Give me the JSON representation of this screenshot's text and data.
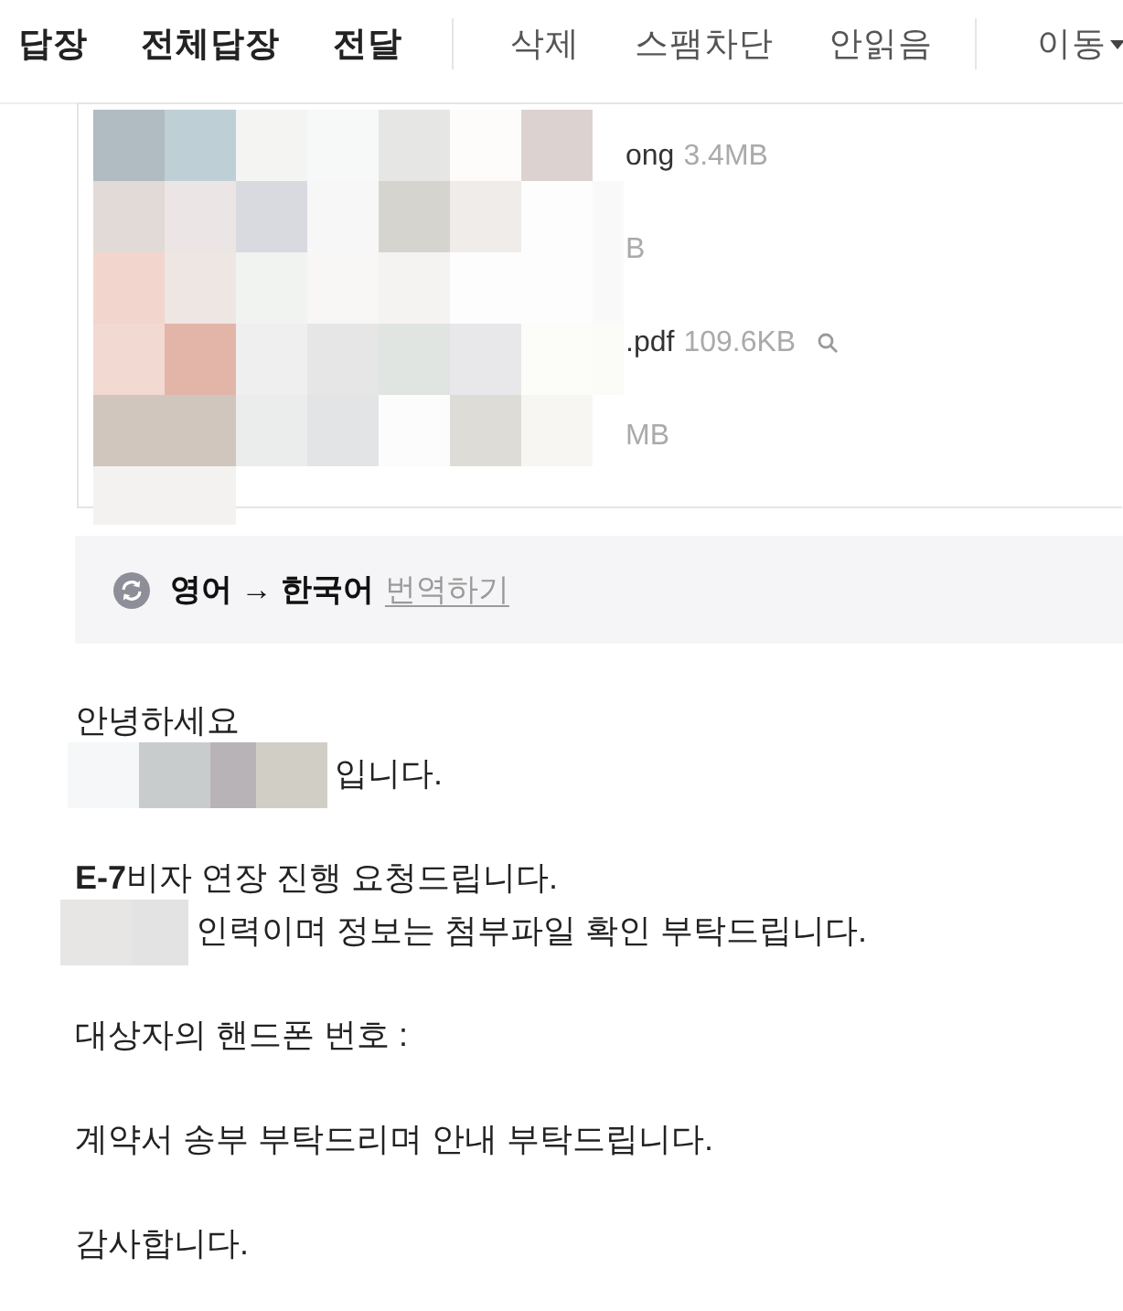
{
  "toolbar": {
    "groups": [
      {
        "kind": "primary",
        "items": [
          {
            "label": "답장",
            "dropdown": false
          },
          {
            "label": "전체답장",
            "dropdown": false
          },
          {
            "label": "전달",
            "dropdown": false
          }
        ]
      },
      {
        "kind": "secondary",
        "items": [
          {
            "label": "삭제",
            "dropdown": false
          },
          {
            "label": "스팸차단",
            "dropdown": false
          },
          {
            "label": "안읽음",
            "dropdown": false
          }
        ]
      },
      {
        "kind": "secondary",
        "items": [
          {
            "label": "이동",
            "dropdown": true
          }
        ]
      }
    ]
  },
  "attachments": [
    {
      "name": "ong",
      "size": "3.4MB"
    },
    {
      "size": "B"
    },
    {
      "name": ".pdf",
      "size": "109.6KB",
      "preview": true
    },
    {
      "size": "MB"
    }
  ],
  "translation": {
    "languages": "영어 → 한국어",
    "action": "번역하기"
  },
  "body": [
    {
      "lines": [
        {
          "text": "안녕하세요",
          "redacted": false
        },
        {
          "text": "입니다.",
          "redacted": true
        }
      ]
    },
    {
      "lines": [
        {
          "text": "**E-7**비자 연장 진행 요청드립니다.",
          "redacted": false
        },
        {
          "text": "인력이며 정보는 첨부파일 확인 부탁드립니다.",
          "redacted": true
        }
      ]
    },
    {
      "lines": [
        {
          "text": "대상자의 핸드폰 번호 :",
          "redacted": false
        }
      ]
    },
    {
      "lines": [
        {
          "text": "계약서 송부 부탁드리며 안내 부탁드립니다.",
          "redacted": false
        }
      ]
    },
    {
      "lines": [
        {
          "text": "감사합니다.",
          "redacted": false
        }
      ]
    }
  ]
}
